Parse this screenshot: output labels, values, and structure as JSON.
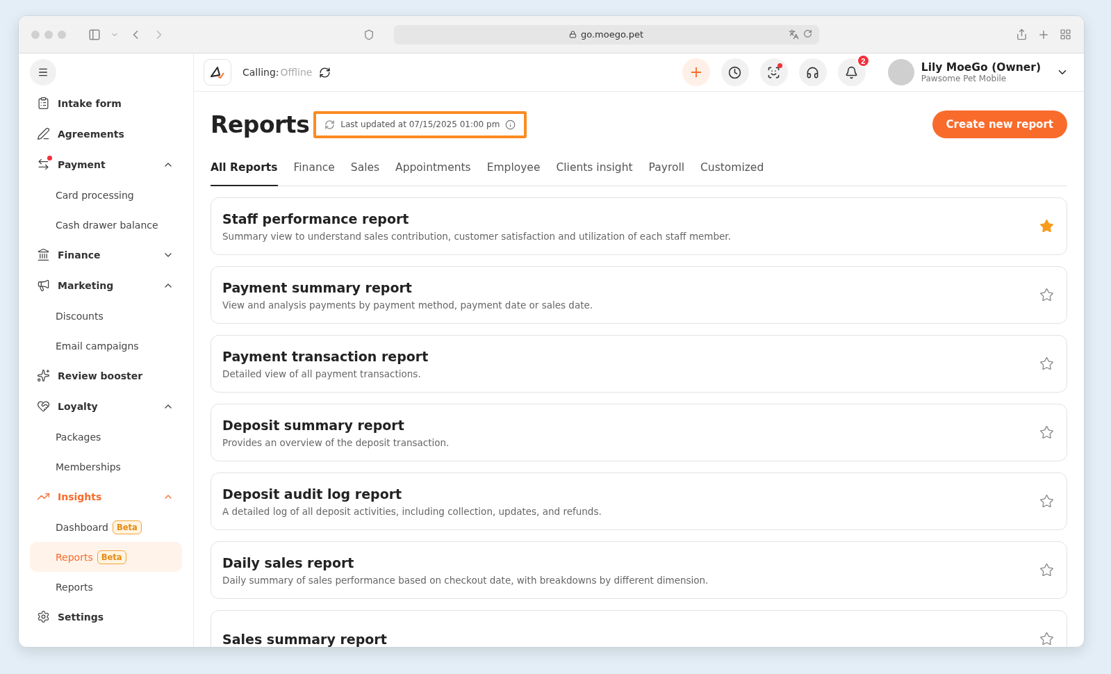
{
  "browser": {
    "url": "go.moego.pet"
  },
  "sidebar": {
    "items": [
      {
        "kind": "section",
        "label": "Intake form",
        "selected": false,
        "alert": false
      },
      {
        "kind": "section",
        "label": "Agreements",
        "selected": false,
        "alert": false
      },
      {
        "kind": "section",
        "label": "Payment",
        "selected": false,
        "alert": true,
        "expanded": true
      },
      {
        "kind": "child",
        "label": "Card processing",
        "selected": false
      },
      {
        "kind": "child",
        "label": "Cash drawer balance",
        "selected": false
      },
      {
        "kind": "section",
        "label": "Finance",
        "selected": false,
        "alert": false,
        "expanded": false
      },
      {
        "kind": "section",
        "label": "Marketing",
        "selected": false,
        "alert": false,
        "expanded": true
      },
      {
        "kind": "child",
        "label": "Discounts",
        "selected": false
      },
      {
        "kind": "child",
        "label": "Email campaigns",
        "selected": false
      },
      {
        "kind": "section",
        "label": "Review booster",
        "selected": false,
        "alert": false
      },
      {
        "kind": "section",
        "label": "Loyalty",
        "selected": false,
        "alert": false,
        "expanded": true
      },
      {
        "kind": "child",
        "label": "Packages",
        "selected": false
      },
      {
        "kind": "child",
        "label": "Memberships",
        "selected": false
      },
      {
        "kind": "section",
        "label": "Insights",
        "selected": true,
        "alert": false,
        "expanded": true
      },
      {
        "kind": "child",
        "label": "Dashboard",
        "badge": "Beta",
        "selected": false
      },
      {
        "kind": "child",
        "label": "Reports",
        "badge": "Beta",
        "selected": true
      },
      {
        "kind": "child",
        "label": "Reports",
        "selected": false
      },
      {
        "kind": "section",
        "label": "Settings",
        "selected": false,
        "alert": false
      }
    ]
  },
  "header": {
    "calling_label": "Calling:",
    "calling_status": "Offline",
    "notification_count": "2",
    "user_name": "Lily MoeGo (Owner)",
    "business": "Pawsome Pet Mobile"
  },
  "page": {
    "title": "Reports",
    "last_updated": "Last updated at 07/15/2025 01:00 pm",
    "highlighted": true,
    "create_button": "Create new report"
  },
  "tabs": [
    {
      "label": "All Reports",
      "selected": true
    },
    {
      "label": "Finance",
      "selected": false
    },
    {
      "label": "Sales",
      "selected": false
    },
    {
      "label": "Appointments",
      "selected": false
    },
    {
      "label": "Employee",
      "selected": false
    },
    {
      "label": "Clients insight",
      "selected": false
    },
    {
      "label": "Payroll",
      "selected": false
    },
    {
      "label": "Customized",
      "selected": false
    }
  ],
  "reports": [
    {
      "title": "Staff performance report",
      "description": "Summary view to understand sales contribution, customer satisfaction and utilization of each staff member.",
      "starred": true
    },
    {
      "title": "Payment summary report",
      "description": "View and analysis payments by payment method, payment date or sales date.",
      "starred": false
    },
    {
      "title": "Payment transaction report",
      "description": "Detailed view of all payment transactions.",
      "starred": false
    },
    {
      "title": "Deposit summary report",
      "description": "Provides an overview of the deposit transaction.",
      "starred": false
    },
    {
      "title": "Deposit audit log report",
      "description": "A detailed log of all deposit activities, including collection, updates, and refunds.",
      "starred": false
    },
    {
      "title": "Daily sales report",
      "description": "Daily summary of sales performance based on checkout date, with breakdowns by different dimension.",
      "starred": false
    },
    {
      "title": "Sales summary report",
      "starred": false
    }
  ]
}
